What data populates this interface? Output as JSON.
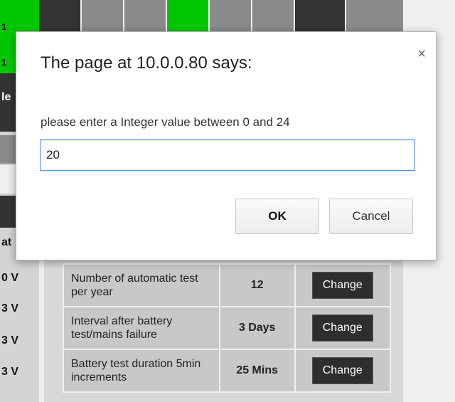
{
  "dialog": {
    "title": "The page at 10.0.0.80 says:",
    "close_glyph": "×",
    "message": "please enter a Integer value between 0 and 24",
    "input_value": "20",
    "ok_label": "OK",
    "cancel_label": "Cancel"
  },
  "background": {
    "top_left_labels": [
      "1",
      "1",
      "le"
    ],
    "left_values": [
      "at",
      "0 V",
      "3 V",
      "3 V",
      "3 V"
    ],
    "settings_rows": [
      {
        "description": "Number of automatic test per year",
        "value": "12",
        "action": "Change"
      },
      {
        "description": "Interval after battery test/mains failure",
        "value": "3 Days",
        "action": "Change"
      },
      {
        "description": "Battery test duration 5min increments",
        "value": "25 Mins",
        "action": "Change"
      }
    ]
  },
  "colors": {
    "accent_green": "#00c800",
    "dark_cell": "#333333",
    "grey_cell": "#8a8a8a",
    "focus_blue": "#4d90fe"
  }
}
